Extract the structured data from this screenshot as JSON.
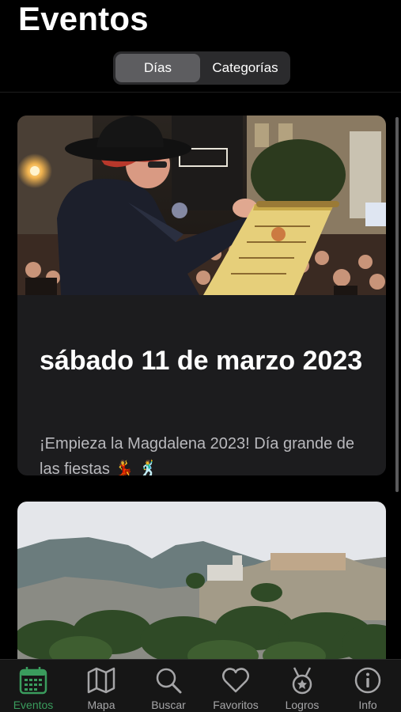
{
  "header": {
    "title": "Eventos"
  },
  "segmented": {
    "options": [
      "Días",
      "Categorías"
    ],
    "selected": "Días"
  },
  "events": [
    {
      "date": "sábado 11 de marzo 2023",
      "description": "¡Empieza la Magdalena 2023! Día grande de las fiestas 💃 🕺"
    },
    {
      "date": "",
      "description": ""
    }
  ],
  "tabbar": {
    "tabs": [
      {
        "label": "Eventos",
        "icon": "calendar-icon",
        "active": true
      },
      {
        "label": "Mapa",
        "icon": "map-icon",
        "active": false
      },
      {
        "label": "Buscar",
        "icon": "search-icon",
        "active": false
      },
      {
        "label": "Favoritos",
        "icon": "heart-icon",
        "active": false
      },
      {
        "label": "Logros",
        "icon": "medal-icon",
        "active": false
      },
      {
        "label": "Info",
        "icon": "info-icon",
        "active": false
      }
    ]
  },
  "colors": {
    "accent": "#3a9c5d",
    "background": "#000000",
    "card": "#1c1c1e",
    "inactive": "#a6a6a8"
  }
}
